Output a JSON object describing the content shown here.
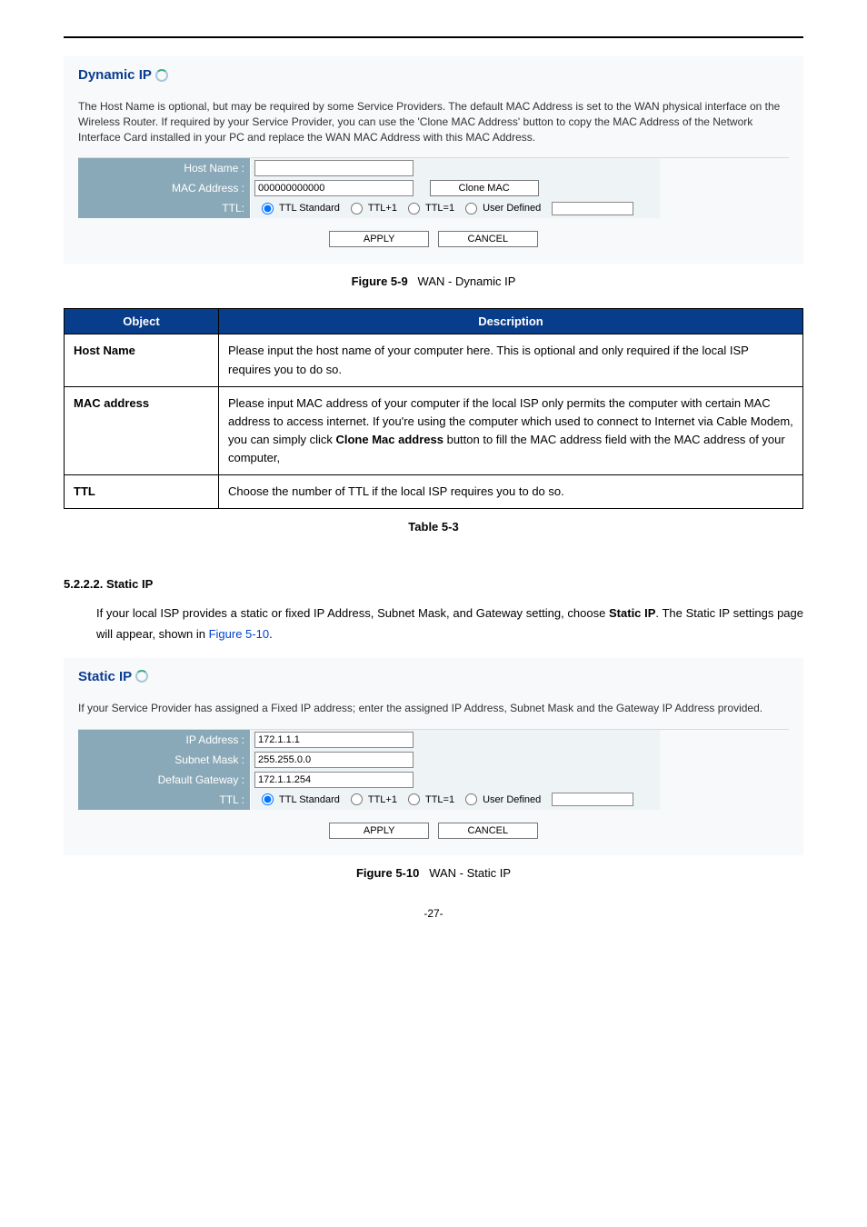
{
  "dynamic": {
    "title": "Dynamic IP",
    "desc": "The Host Name is optional, but may be required by some Service Providers. The default MAC Address is set to the WAN physical interface on the Wireless Router. If required by your Service Provider, you can use the 'Clone MAC Address' button to copy the MAC Address of the Network Interface Card installed in your PC and replace the WAN MAC Address with this MAC Address.",
    "labels": {
      "host_name": "Host Name :",
      "mac_address": "MAC Address :",
      "ttl": "TTL:"
    },
    "values": {
      "host_name": "",
      "mac_address": "000000000000"
    },
    "buttons": {
      "clone_mac": "Clone MAC",
      "apply": "APPLY",
      "cancel": "CANCEL"
    },
    "ttl_options": {
      "standard": "TTL Standard",
      "plus1": "TTL+1",
      "eq1": "TTL=1",
      "user": "User Defined"
    }
  },
  "fig59": {
    "label": "Figure 5-9",
    "caption": "WAN - Dynamic IP"
  },
  "table": {
    "head": {
      "object": "Object",
      "desc": "Description"
    },
    "rows": [
      {
        "obj": "Host Name",
        "desc": "Please input the host name of your computer here. This is optional and only required if the local ISP requires you to do so."
      },
      {
        "obj": "MAC address",
        "desc_pre": "Please input MAC address of your computer if the local ISP only permits the computer with certain MAC address to access internet. If you're using the computer which used to connect to Internet via Cable Modem, you can simply click ",
        "desc_bold": "Clone Mac address",
        "desc_post": " button to fill the MAC address field with the MAC address of your computer,"
      },
      {
        "obj": "TTL",
        "desc": "Choose the number of TTL if the local ISP requires you to do so."
      }
    ],
    "caption": "Table 5-3"
  },
  "section": {
    "num": "5.2.2.2.",
    "title": "Static IP",
    "p_pre": "If your local ISP provides a static or fixed IP Address, Subnet Mask, and Gateway setting, choose ",
    "p_bold": "Static IP",
    "p_mid": ". The Static IP settings page will appear, shown in ",
    "p_link": "Figure 5-10",
    "p_end": "."
  },
  "static": {
    "title": "Static IP",
    "desc": "If your Service Provider has assigned a Fixed IP address; enter the assigned IP Address, Subnet Mask and the Gateway IP Address provided.",
    "labels": {
      "ip": "IP Address :",
      "mask": "Subnet Mask :",
      "gw": "Default Gateway :",
      "ttl": "TTL :"
    },
    "values": {
      "ip": "172.1.1.1",
      "mask": "255.255.0.0",
      "gw": "172.1.1.254"
    },
    "ttl_options": {
      "standard": "TTL Standard",
      "plus1": "TTL+1",
      "eq1": "TTL=1",
      "user": "User Defined"
    },
    "buttons": {
      "apply": "APPLY",
      "cancel": "CANCEL"
    }
  },
  "fig510": {
    "label": "Figure 5-10",
    "caption": "WAN - Static IP"
  },
  "page_number": "-27-"
}
